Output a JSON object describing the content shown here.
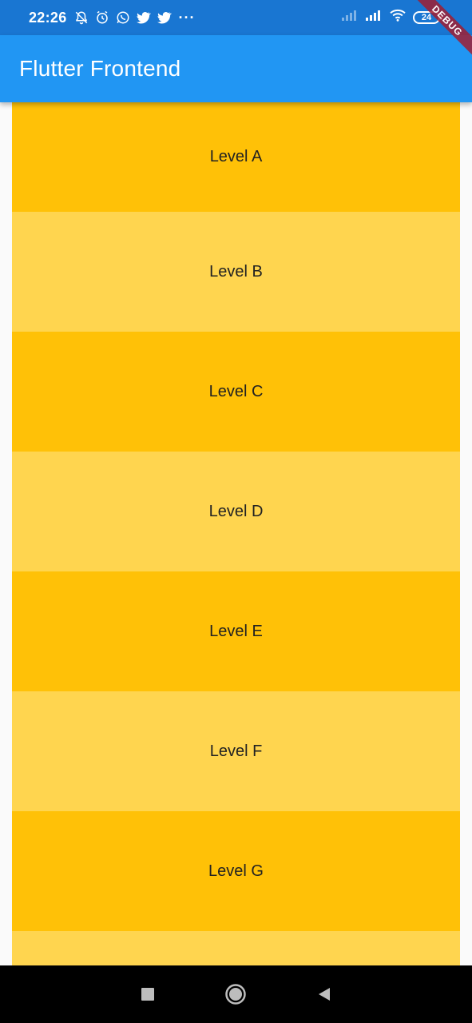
{
  "status_bar": {
    "time": "22:26",
    "battery": "24",
    "icons": [
      "notifications-off-icon",
      "alarm-icon",
      "whatsapp-icon",
      "twitter-icon",
      "twitter-icon"
    ],
    "overflow": "···"
  },
  "debug_banner": "DEBUG",
  "app_bar": {
    "title": "Flutter Frontend"
  },
  "levels": [
    {
      "label": "Level A"
    },
    {
      "label": "Level B"
    },
    {
      "label": "Level C"
    },
    {
      "label": "Level D"
    },
    {
      "label": "Level E"
    },
    {
      "label": "Level F"
    },
    {
      "label": "Level G"
    },
    {
      "label": ""
    }
  ],
  "colors": {
    "status_bar": "#1976d2",
    "app_bar": "#2196f3",
    "level_dark": "#ffc107",
    "level_light": "#ffd54f",
    "nav_bar": "#000000"
  }
}
